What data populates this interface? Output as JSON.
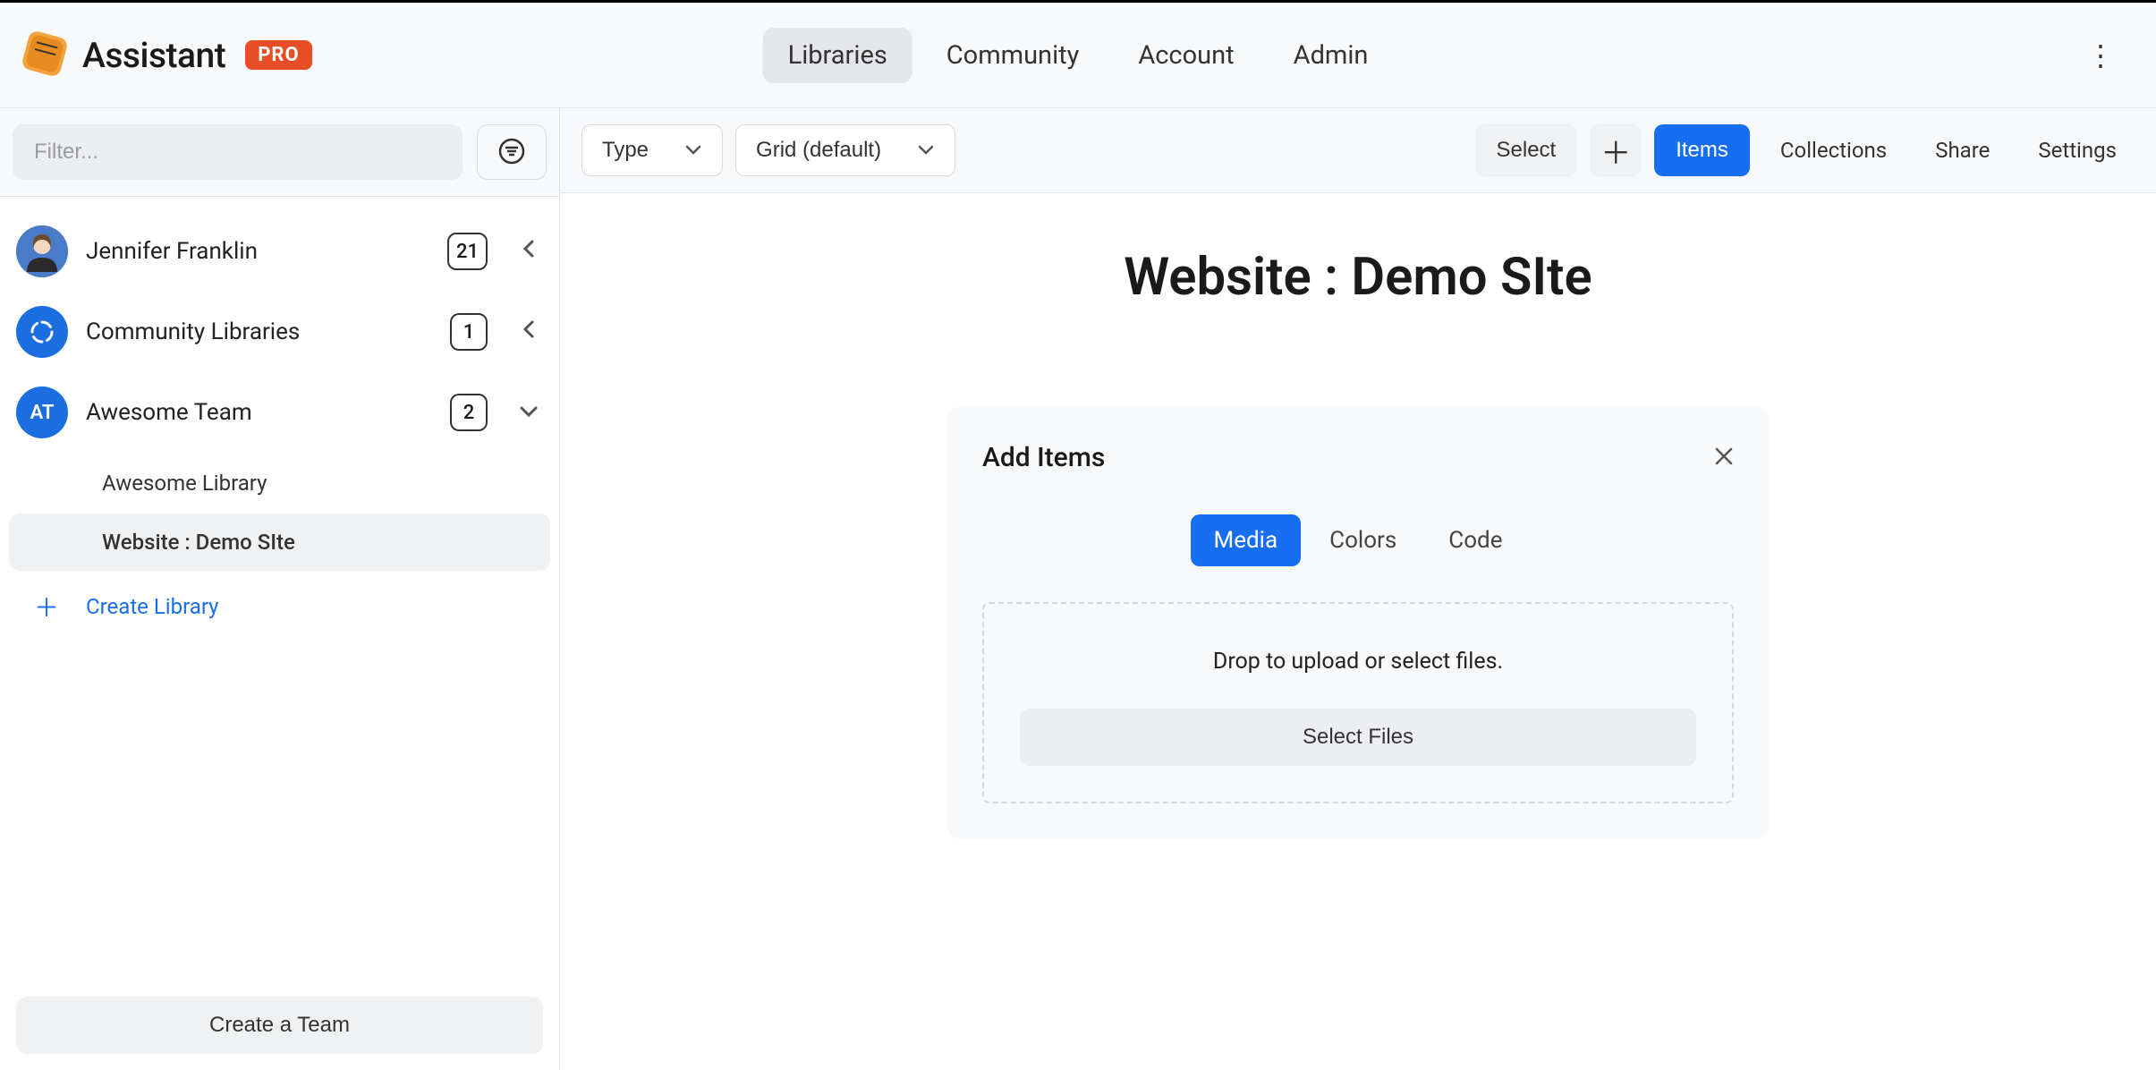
{
  "brand": {
    "name": "Assistant",
    "badge": "PRO"
  },
  "nav": {
    "items": [
      "Libraries",
      "Community",
      "Account",
      "Admin"
    ],
    "active": 0
  },
  "sidebar": {
    "filter_placeholder": "Filter...",
    "groups": [
      {
        "label": "Jennifer Franklin",
        "count": "21",
        "avatar_type": "user",
        "expanded": false
      },
      {
        "label": "Community Libraries",
        "count": "1",
        "avatar_type": "comm",
        "expanded": false
      },
      {
        "label": "Awesome Team",
        "count": "2",
        "avatar_type": "team",
        "avatar_text": "AT",
        "expanded": true,
        "children": [
          "Awesome Library",
          "Website : Demo SIte"
        ],
        "active_child": 1
      }
    ],
    "create_library": "Create Library",
    "create_team": "Create a Team"
  },
  "toolbar": {
    "type_label": "Type",
    "view_label": "Grid (default)",
    "select_label": "Select",
    "items_label": "Items",
    "collections_label": "Collections",
    "share_label": "Share",
    "settings_label": "Settings"
  },
  "page": {
    "title": "Website : Demo SIte",
    "add_card": {
      "title": "Add Items",
      "tabs": [
        "Media",
        "Colors",
        "Code"
      ],
      "active_tab": 0,
      "drop_text": "Drop to upload or select files.",
      "select_files": "Select Files"
    }
  }
}
